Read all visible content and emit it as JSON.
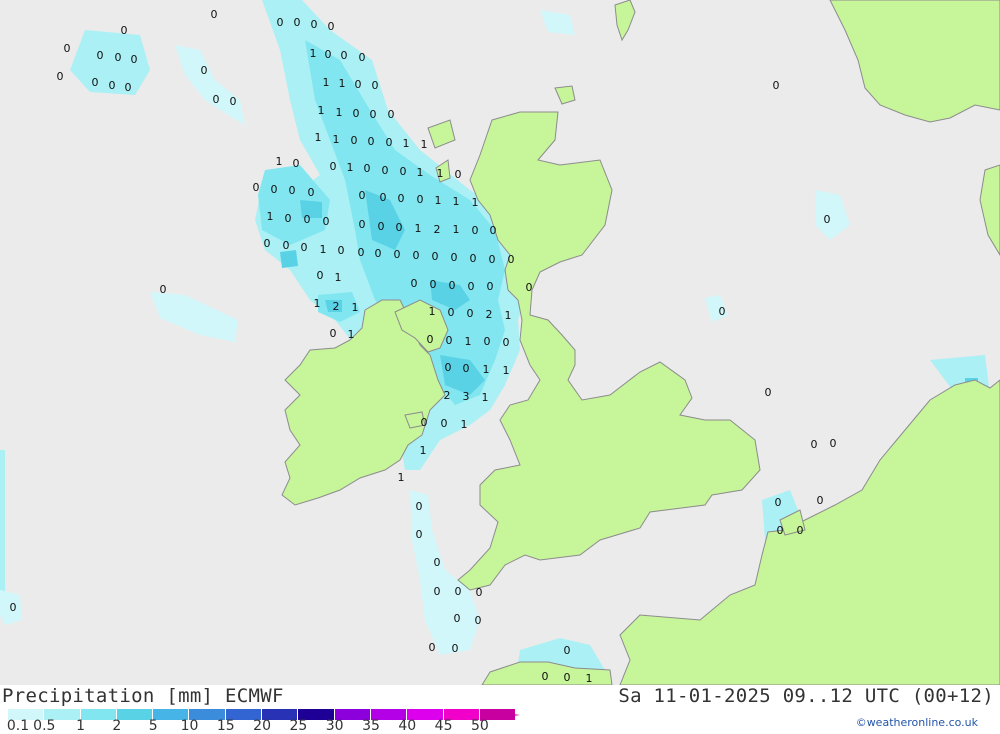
{
  "map": {
    "sea_color": "#ebebeb",
    "land_color": "#c7f59a",
    "border_color": "#8c8c8c",
    "values": [
      "0",
      "0",
      "0",
      "0",
      "0",
      "0",
      "0",
      "0",
      "0",
      "0",
      "0",
      "0",
      "0",
      "0",
      "0",
      "0",
      "0",
      "1",
      "0",
      "0",
      "0",
      "1",
      "1",
      "0",
      "0",
      "1",
      "1",
      "0",
      "0",
      "0",
      "1",
      "1",
      "0",
      "0",
      "0",
      "1",
      "1",
      "0",
      "1",
      "0",
      "0",
      "0",
      "1",
      "1",
      "0",
      "1",
      "0",
      "0",
      "0",
      "0",
      "0",
      "0",
      "0",
      "0",
      "0",
      "1",
      "1",
      "1",
      "1",
      "0",
      "0",
      "0",
      "0",
      "0",
      "0",
      "1",
      "2",
      "1",
      "0",
      "0",
      "0",
      "0",
      "0",
      "1",
      "0",
      "0",
      "0",
      "0",
      "0",
      "0",
      "0",
      "0",
      "0",
      "0",
      "0",
      "1",
      "0",
      "0",
      "0",
      "0",
      "0",
      "0",
      "0",
      "1",
      "2",
      "1",
      "1",
      "0",
      "0",
      "2",
      "1",
      "0",
      "0",
      "1",
      "0",
      "0",
      "1",
      "0",
      "0",
      "0",
      "0",
      "1",
      "1",
      "0",
      "2",
      "3",
      "1",
      "0",
      "0",
      "1",
      "1",
      "1",
      "0",
      "0",
      "0",
      "0",
      "0",
      "0",
      "0",
      "0",
      "0",
      "0",
      "0",
      "0",
      "0",
      "0",
      "0",
      "1",
      "0",
      "0",
      "0",
      "0",
      "0",
      "0",
      "0",
      "0",
      "1",
      "1",
      "0",
      "0",
      "0"
    ]
  },
  "footer": {
    "title": "Precipitation [mm] ECMWF",
    "valid": "Sa 11-01-2025 09..12 UTC (00+12)",
    "credit": "©weatheronline.co.uk",
    "legend": {
      "labels": [
        "0.1",
        "0.5",
        "1",
        "2",
        "5",
        "10",
        "15",
        "20",
        "25",
        "30",
        "35",
        "40",
        "45",
        "50"
      ],
      "colors": [
        "#d2f7fa",
        "#aaf0f5",
        "#82e6f0",
        "#5ad2e6",
        "#46b4e6",
        "#3c8cdc",
        "#3264d2",
        "#2832b4",
        "#1e0096",
        "#8c00dc",
        "#b400e6",
        "#dc00ec",
        "#f000c8",
        "#c800a0"
      ]
    }
  }
}
